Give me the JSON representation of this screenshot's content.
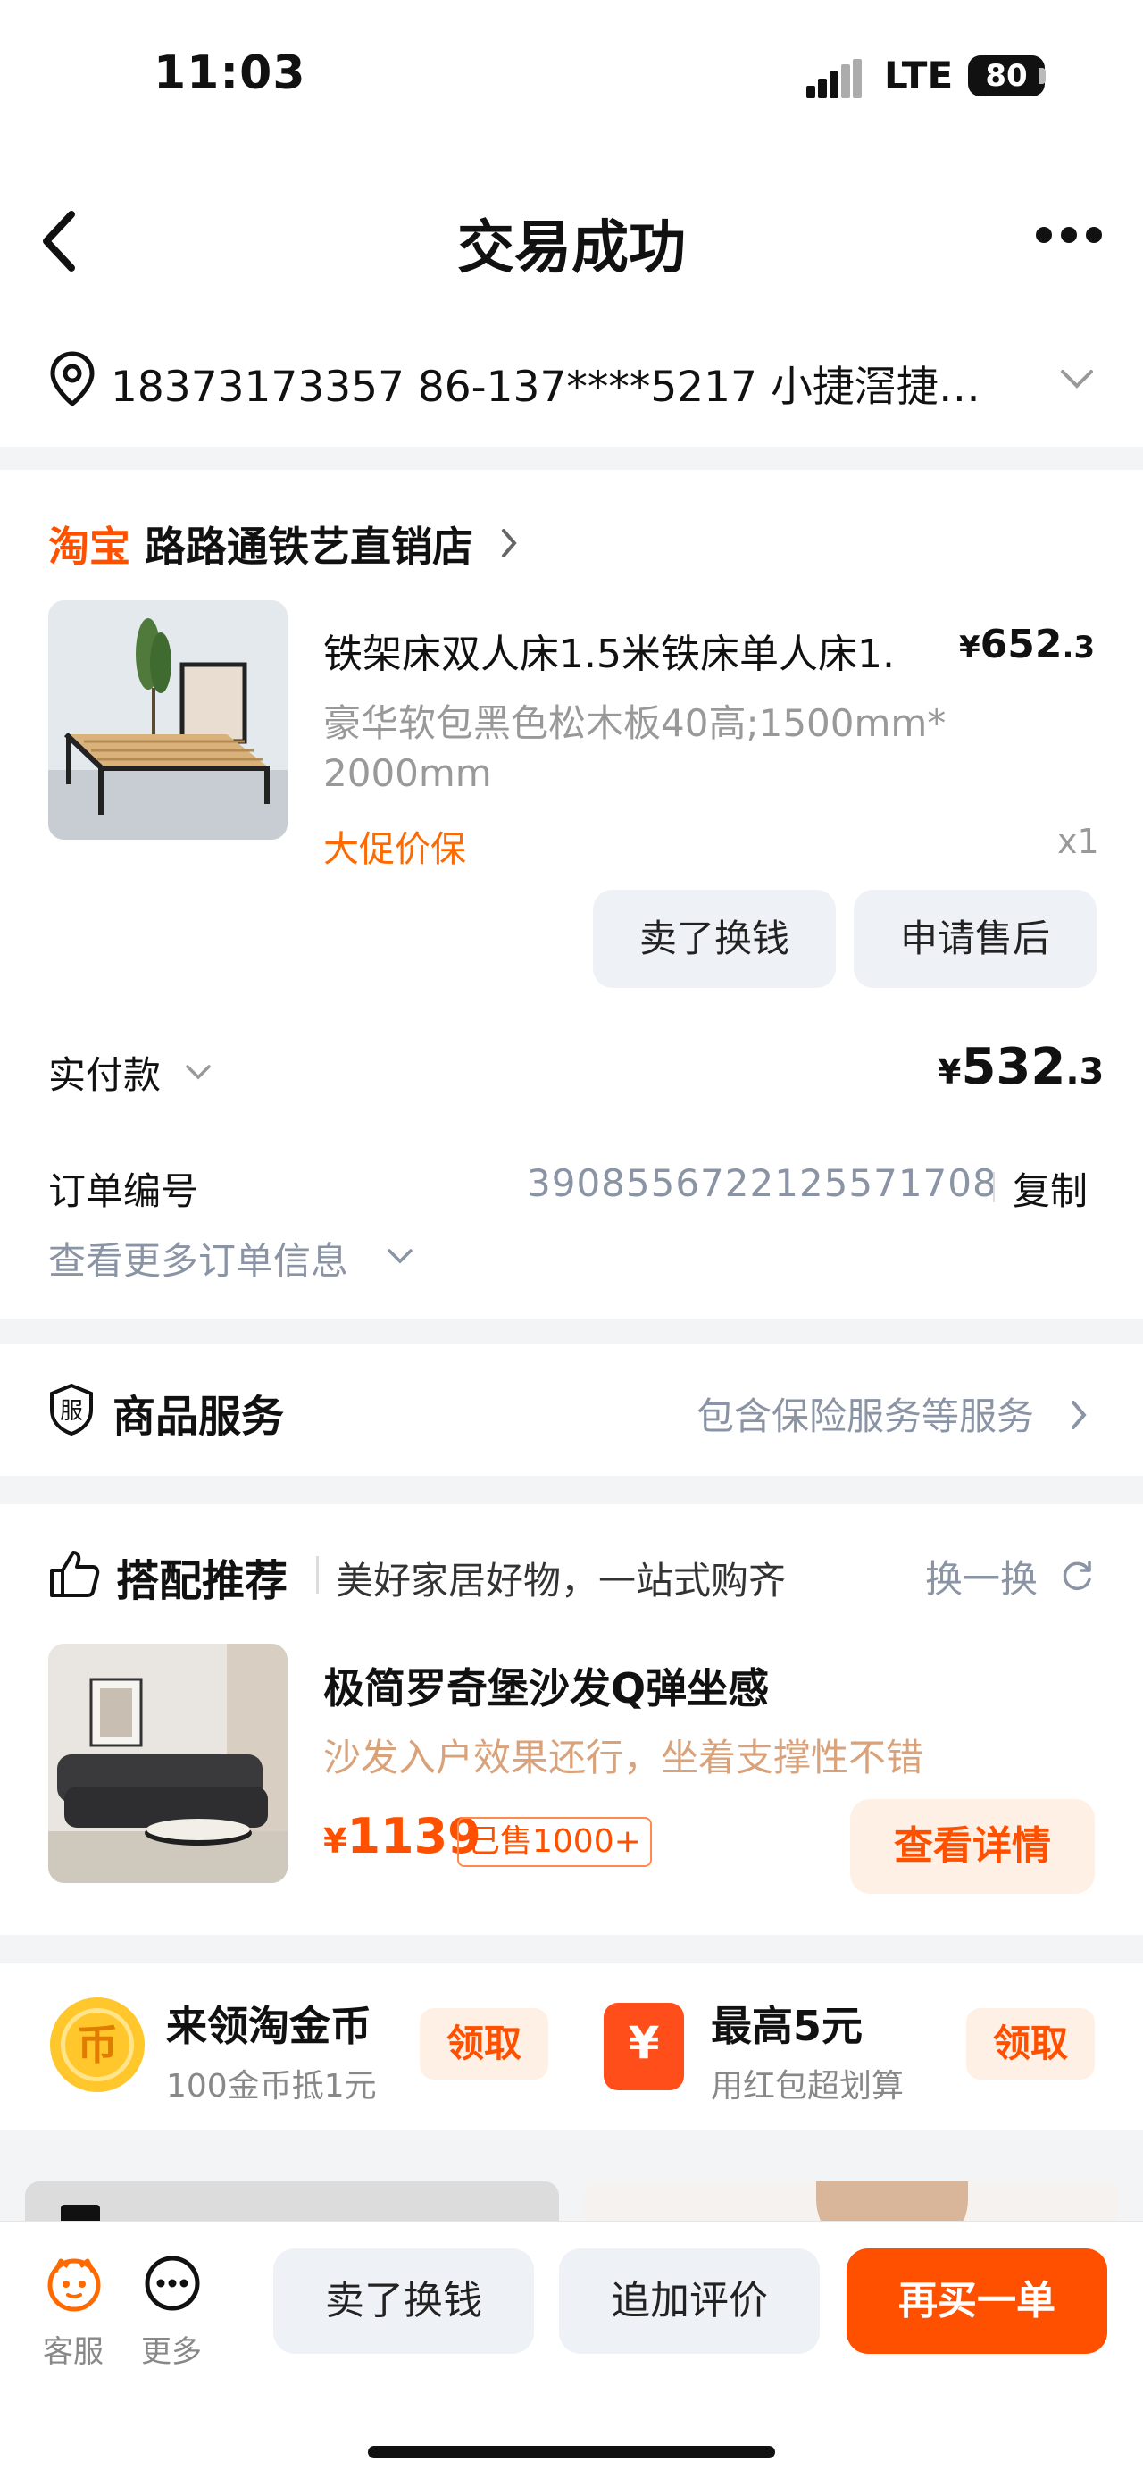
{
  "status_bar": {
    "time": "11:03",
    "network": "LTE",
    "battery": "80"
  },
  "header": {
    "title": "交易成功"
  },
  "address": {
    "text": "18373173357 86-137****5217 小捷滘捷…"
  },
  "order": {
    "platform": "淘宝",
    "shop_name": "路路通铁艺直销店",
    "item": {
      "title": "铁架床双人床1.5米铁床单人床1.",
      "price_currency": "¥",
      "price_int": "652",
      "price_dec": ".3",
      "sku": "豪华软包黑色松木板40高;1500mm*2000mm",
      "promo": "大促价保",
      "qty": "x1"
    },
    "buttons": {
      "sell": "卖了换钱",
      "after_sale": "申请售后"
    },
    "paid_label": "实付款",
    "paid_currency": "¥",
    "paid_int": "532",
    "paid_dec": ".3",
    "order_no_label": "订单编号",
    "order_no": "3908556722125571708",
    "copy_label": "复制",
    "more_info": "查看更多订单信息"
  },
  "service": {
    "icon": "服",
    "title": "商品服务",
    "desc": "包含保险服务等服务"
  },
  "recommend": {
    "title": "搭配推荐",
    "subtitle": "美好家居好物，一站式购齐",
    "swap": "换一换",
    "item": {
      "name": "极简罗奇堡沙发Q弹坐感",
      "desc": "沙发入户效果还行，坐着支撑性不错",
      "price_currency": "¥",
      "price": "1139",
      "sold": "已售1000+",
      "detail_button": "查看详情"
    }
  },
  "coins": {
    "coin_glyph": "币",
    "coin_title": "来领淘金币",
    "coin_sub": "100金币抵1元",
    "claim_label": "领取",
    "red_glyph": "¥",
    "red_title": "最高5元",
    "red_sub": "用红包超划算",
    "claim_label_2": "领取"
  },
  "bottom_bar": {
    "service_label": "客服",
    "more_label": "更多",
    "sell_label": "卖了换钱",
    "review_label": "追加评价",
    "rebuy_label": "再买一单"
  },
  "colors": {
    "accent": "#ff5000",
    "muted": "#8a94a4",
    "background": "#f3f4f6"
  }
}
